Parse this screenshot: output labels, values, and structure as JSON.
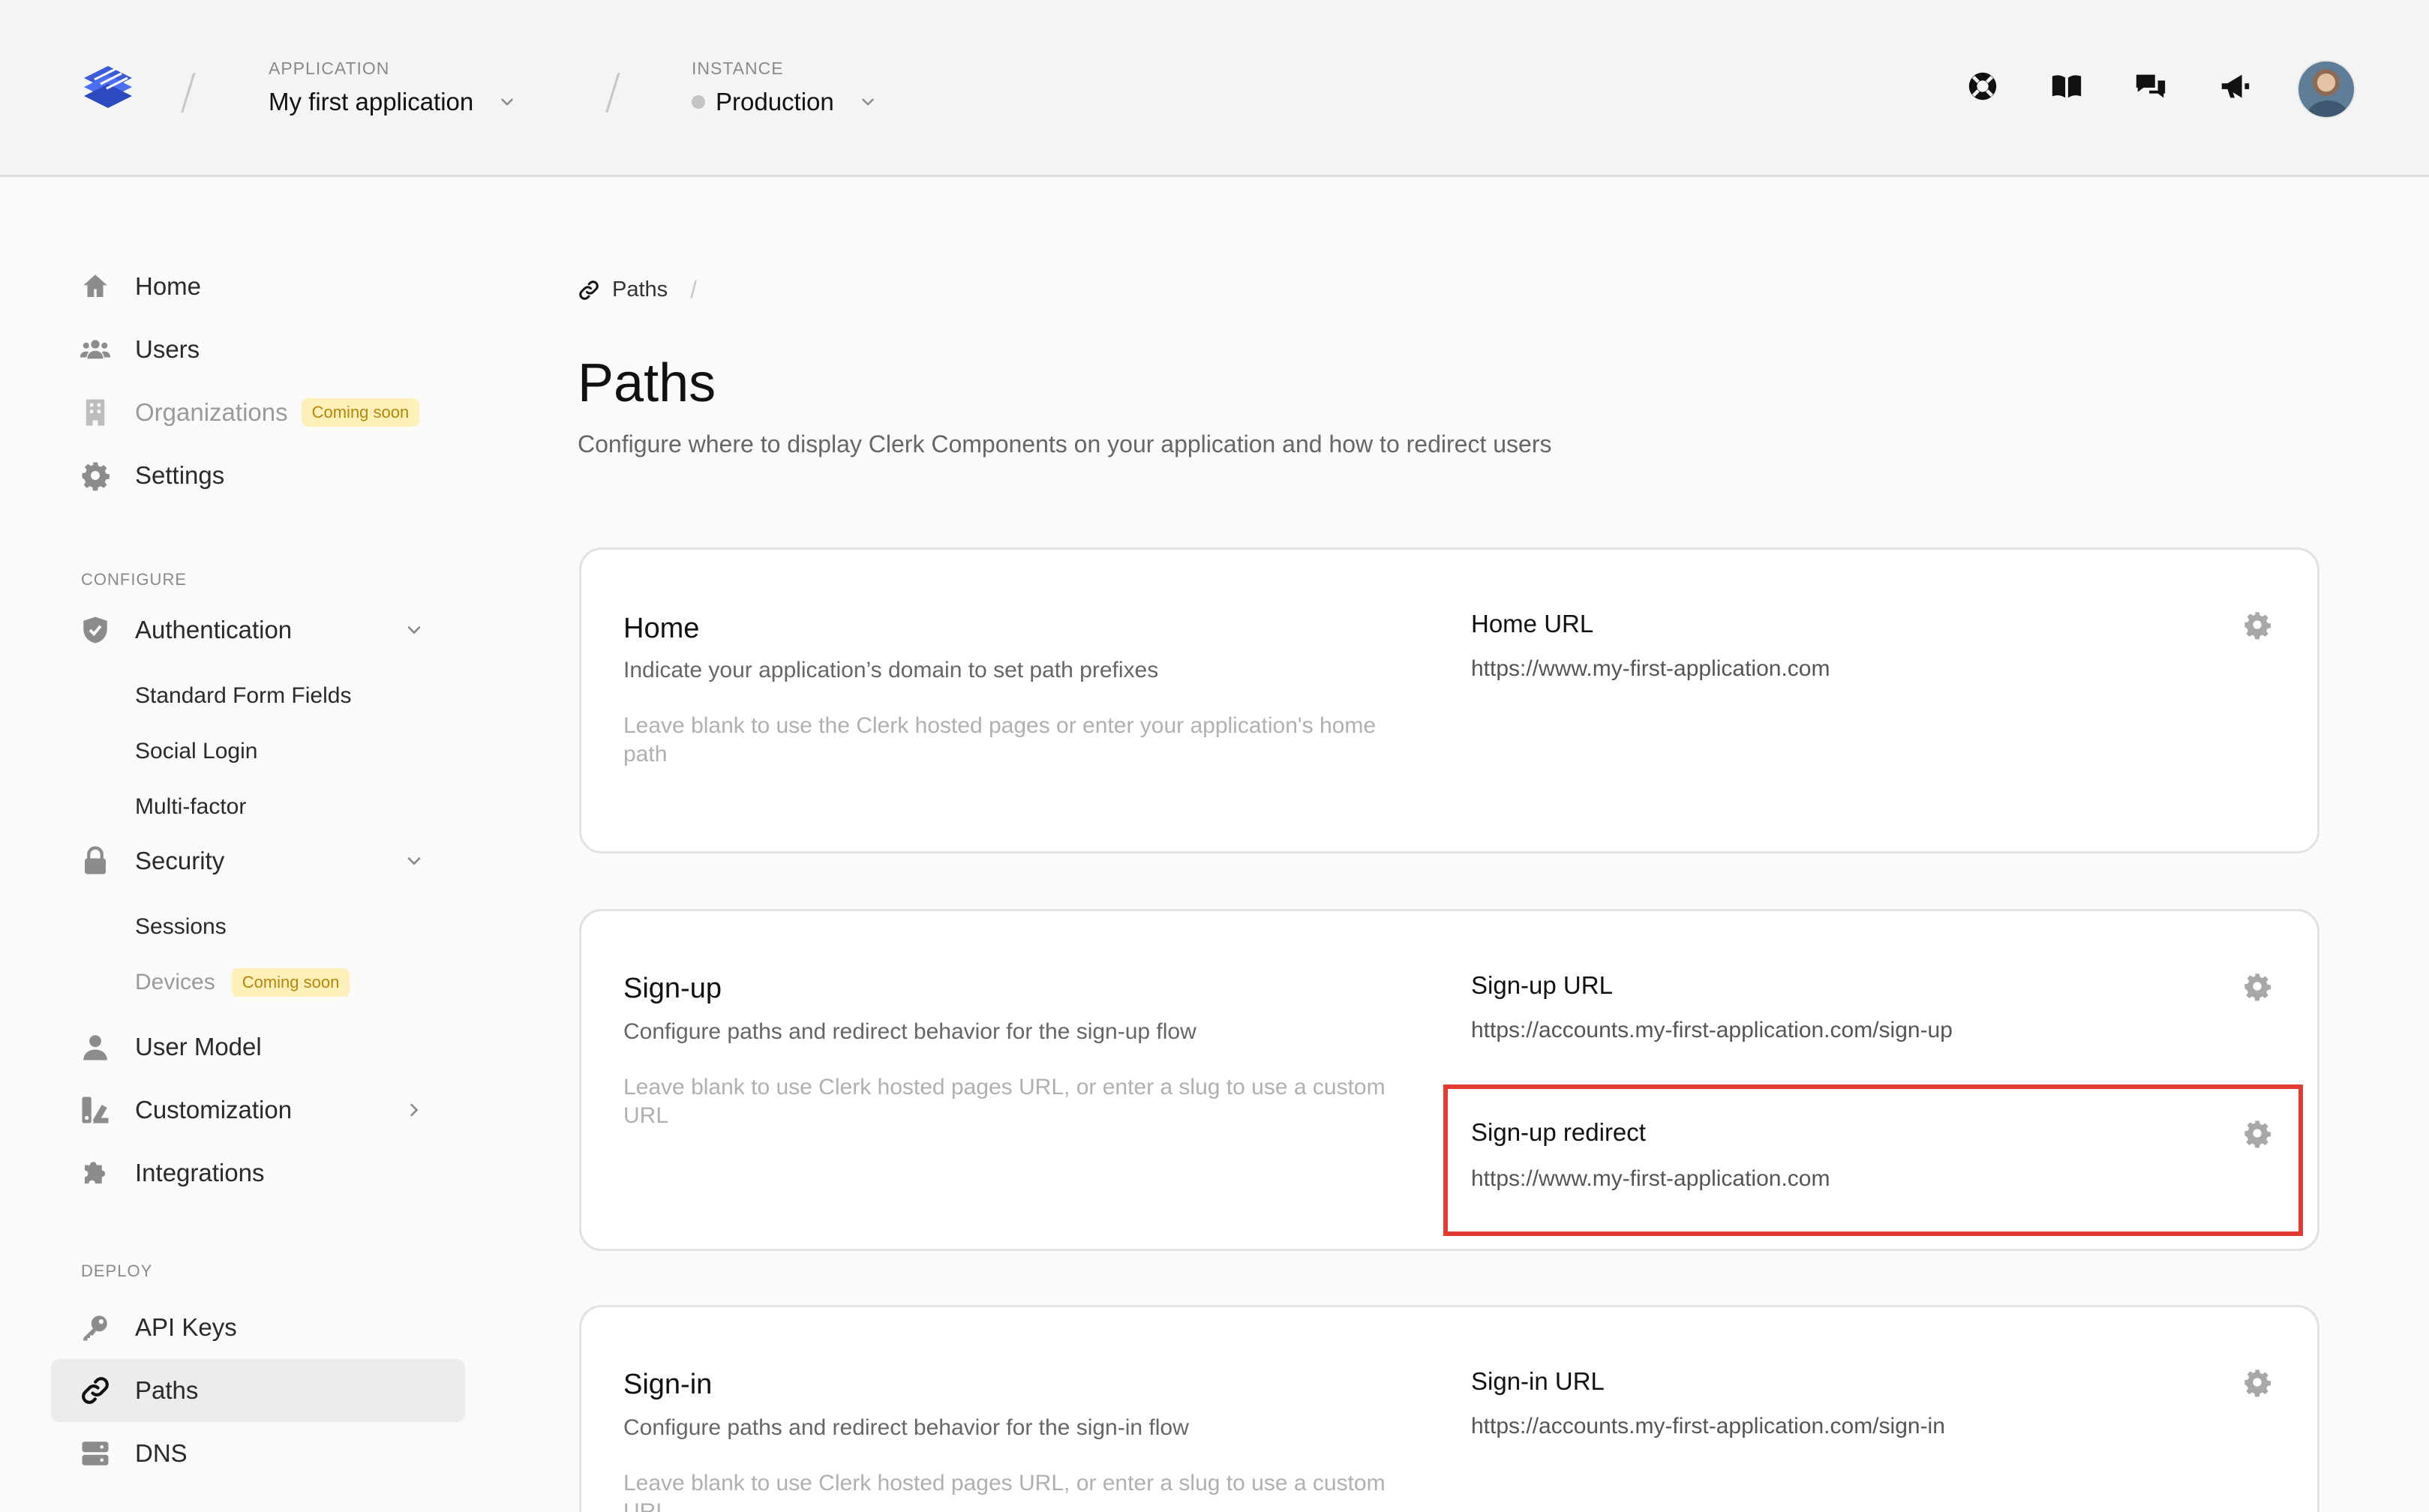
{
  "header": {
    "application_label": "APPLICATION",
    "application_name": "My first application",
    "instance_label": "INSTANCE",
    "instance_name": "Production"
  },
  "sidebar": {
    "items": [
      {
        "label": "Home",
        "icon": "home-icon"
      },
      {
        "label": "Users",
        "icon": "users-icon"
      },
      {
        "label": "Organizations",
        "icon": "building-icon",
        "badge": "Coming soon"
      },
      {
        "label": "Settings",
        "icon": "gear-icon"
      }
    ],
    "configure_label": "CONFIGURE",
    "configure": {
      "authentication": "Authentication",
      "auth_sub": [
        "Standard Form Fields",
        "Social Login",
        "Multi-factor"
      ],
      "security": "Security",
      "security_sub": {
        "sessions": "Sessions",
        "devices": "Devices",
        "devices_badge": "Coming soon"
      },
      "user_model": "User Model",
      "customization": "Customization",
      "integrations": "Integrations"
    },
    "deploy_label": "DEPLOY",
    "deploy": {
      "api_keys": "API Keys",
      "paths": "Paths",
      "dns": "DNS"
    }
  },
  "breadcrumb": {
    "current": "Paths",
    "separator": "/"
  },
  "page": {
    "title": "Paths",
    "subtitle": "Configure where to display Clerk Components on your application and how to redirect users"
  },
  "cards": {
    "home": {
      "title": "Home",
      "description": "Indicate your application’s domain to set path prefixes",
      "hint": "Leave blank to use the Clerk hosted pages or enter your application's home path",
      "fields": [
        {
          "label": "Home URL",
          "value": "https://www.my-first-application.com"
        }
      ]
    },
    "signup": {
      "title": "Sign-up",
      "description": "Configure paths and redirect behavior for the sign-up flow",
      "hint": "Leave blank to use Clerk hosted pages URL, or enter a slug to use a custom URL",
      "fields": [
        {
          "label": "Sign-up URL",
          "value": "https://accounts.my-first-application.com/sign-up"
        },
        {
          "label": "Sign-up redirect",
          "value": "https://www.my-first-application.com"
        }
      ]
    },
    "signin": {
      "title": "Sign-in",
      "description": "Configure paths and redirect behavior for the sign-in flow",
      "hint": "Leave blank to use Clerk hosted pages URL, or enter a slug to use a custom URL",
      "fields": [
        {
          "label": "Sign-in URL",
          "value": "https://accounts.my-first-application.com/sign-in"
        }
      ]
    }
  },
  "colors": {
    "accent": "#3b5bdb",
    "highlight": "#e23b34",
    "badge_bg": "#fdf0b8",
    "badge_text": "#b5860a"
  }
}
